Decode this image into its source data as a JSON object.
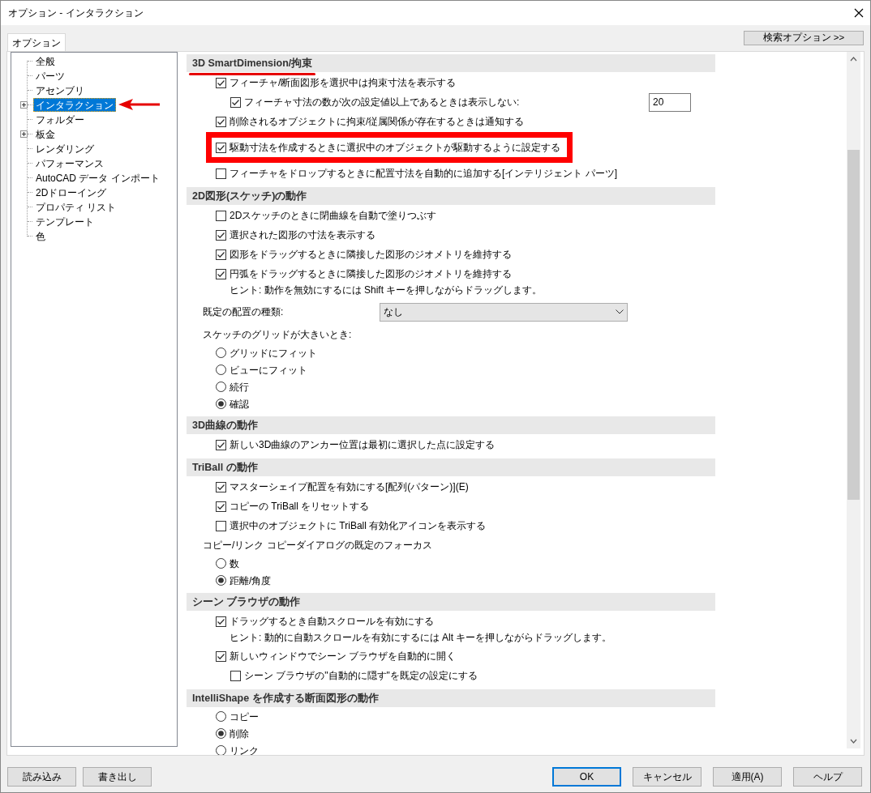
{
  "window": {
    "title": "オプション - インタラクション"
  },
  "tabs": [
    {
      "label": "オプション",
      "selected": true
    }
  ],
  "search_options_button": "検索オプション >>",
  "tree": [
    {
      "label": "全般",
      "expandable": false,
      "selected": false
    },
    {
      "label": "パーツ",
      "expandable": false,
      "selected": false
    },
    {
      "label": "アセンブリ",
      "expandable": false,
      "selected": false
    },
    {
      "label": "インタラクション",
      "expandable": true,
      "selected": true,
      "pointer_arrow": true
    },
    {
      "label": "フォルダー",
      "expandable": false,
      "selected": false
    },
    {
      "label": "板金",
      "expandable": true,
      "selected": false
    },
    {
      "label": "レンダリング",
      "expandable": false,
      "selected": false
    },
    {
      "label": "パフォーマンス",
      "expandable": false,
      "selected": false
    },
    {
      "label": "AutoCAD データ インポート",
      "expandable": false,
      "selected": false
    },
    {
      "label": "2Dドローイング",
      "expandable": false,
      "selected": false
    },
    {
      "label": "プロパティ リスト",
      "expandable": false,
      "selected": false
    },
    {
      "label": "テンプレート",
      "expandable": false,
      "selected": false
    },
    {
      "label": "色",
      "expandable": false,
      "selected": false
    }
  ],
  "sections": [
    {
      "title": "3D SmartDimension/拘束",
      "underlined": true,
      "items": [
        {
          "kind": "checkbox",
          "label": "フィーチャ/断面図形を選択中は拘束寸法を表示する",
          "checked": true,
          "children": [
            {
              "kind": "checkbox",
              "label": "フィーチャ寸法の数が次の設定値以上であるときは表示しない:",
              "checked": true,
              "value": "20"
            }
          ]
        },
        {
          "kind": "checkbox",
          "label": "削除されるオブジェクトに拘束/従属関係が存在するときは通知する",
          "checked": true
        },
        {
          "kind": "checkbox",
          "label": "駆動寸法を作成するときに選択中のオブジェクトが駆動するように設定する",
          "checked": true,
          "highlighted": true
        },
        {
          "kind": "checkbox",
          "label": "フィーチャをドロップするときに配置寸法を自動的に追加する[インテリジェント パーツ]",
          "checked": false
        }
      ]
    },
    {
      "title": "2D図形(スケッチ)の動作",
      "items": [
        {
          "kind": "checkbox",
          "label": "2Dスケッチのときに閉曲線を自動で塗りつぶす",
          "checked": false
        },
        {
          "kind": "checkbox",
          "label": "選択された図形の寸法を表示する",
          "checked": true
        },
        {
          "kind": "checkbox",
          "label": "図形をドラッグするときに隣接した図形のジオメトリを維持する",
          "checked": true
        },
        {
          "kind": "checkbox",
          "label": "円弧をドラッグするときに隣接した図形のジオメトリを維持する",
          "checked": true
        },
        {
          "kind": "hint",
          "label": "ヒント: 動作を無効にするには Shift キーを押しながらドラッグします。"
        },
        {
          "kind": "dropdown",
          "label": "既定の配置の種類:",
          "value": "なし"
        },
        {
          "kind": "radio_group",
          "label": "スケッチのグリッドが大きいとき:",
          "options": [
            {
              "label": "グリッドにフィット",
              "selected": false
            },
            {
              "label": "ビューにフィット",
              "selected": false
            },
            {
              "label": "続行",
              "selected": false
            },
            {
              "label": "確認",
              "selected": true
            }
          ]
        }
      ]
    },
    {
      "title": "3D曲線の動作",
      "items": [
        {
          "kind": "checkbox",
          "label": "新しい3D曲線のアンカー位置は最初に選択した点に設定する",
          "checked": true
        }
      ]
    },
    {
      "title": "TriBall の動作",
      "items": [
        {
          "kind": "checkbox",
          "label": "マスターシェイプ配置を有効にする[配列(パターン)](E)",
          "checked": true
        },
        {
          "kind": "checkbox",
          "label": "コピーの TriBall をリセットする",
          "checked": true
        },
        {
          "kind": "checkbox",
          "label": "選択中のオブジェクトに TriBall 有効化アイコンを表示する",
          "checked": false
        },
        {
          "kind": "radio_group",
          "label": "コピー/リンク コピーダイアログの既定のフォーカス",
          "options": [
            {
              "label": "数",
              "selected": false
            },
            {
              "label": "距離/角度",
              "selected": true
            }
          ]
        }
      ]
    },
    {
      "title": "シーン ブラウザの動作",
      "items": [
        {
          "kind": "checkbox",
          "label": "ドラッグするとき自動スクロールを有効にする",
          "checked": true
        },
        {
          "kind": "hint",
          "label": "ヒント: 動的に自動スクロールを有効にするには Alt キーを押しながらドラッグします。"
        },
        {
          "kind": "checkbox",
          "label": "新しいウィンドウでシーン ブラウザを自動的に開く",
          "checked": true,
          "children": [
            {
              "kind": "checkbox",
              "label": "シーン ブラウザの\"自動的に隠す\"を既定の設定にする",
              "checked": false
            }
          ]
        }
      ]
    },
    {
      "title": "IntelliShape を作成する断面図形の動作",
      "items": [
        {
          "kind": "radio_group",
          "options": [
            {
              "label": "コピー",
              "selected": false
            },
            {
              "label": "削除",
              "selected": true
            },
            {
              "label": "リンク",
              "selected": false
            }
          ]
        }
      ]
    }
  ],
  "footer_left_buttons": [
    "読み込み",
    "書き出し"
  ],
  "footer_right_buttons": [
    {
      "label": "OK",
      "default": true
    },
    {
      "label": "キャンセル",
      "default": false
    },
    {
      "label": "適用(A)",
      "default": false
    },
    {
      "label": "ヘルプ",
      "default": false
    }
  ]
}
